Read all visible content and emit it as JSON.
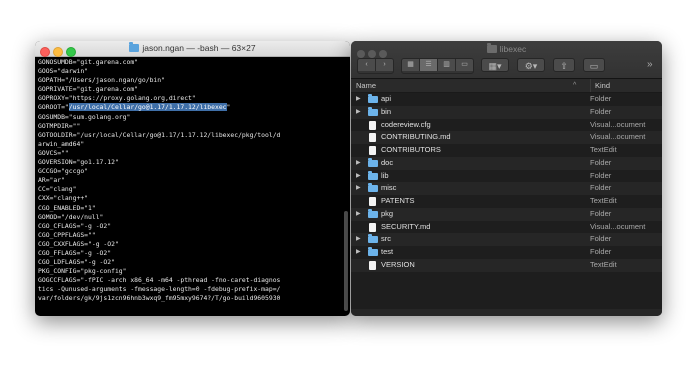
{
  "terminal": {
    "title": "jason.ngan — -bash — 63×27",
    "lines": [
      "GONOSUMDB=\"git.garena.com\"",
      "GOOS=\"darwin\"",
      "GOPATH=\"/Users/jason.ngan/go/bin\"",
      "GOPRIVATE=\"git.garena.com\"",
      "GOPROXY=\"https://proxy.golang.org,direct\"",
      "GOROOT=\"",
      "GOSUMDB=\"sum.golang.org\"",
      "GOTMPDIR=\"\"",
      "GOTOOLDIR=\"/usr/local/Cellar/go@1.17/1.17.12/libexec/pkg/tool/d",
      "arwin_amd64\"",
      "GOVCS=\"\"",
      "GOVERSION=\"go1.17.12\"",
      "GCCGO=\"gccgo\"",
      "AR=\"ar\"",
      "CC=\"clang\"",
      "CXX=\"clang++\"",
      "CGO_ENABLED=\"1\"",
      "GOMOD=\"/dev/null\"",
      "CGO_CFLAGS=\"-g -O2\"",
      "CGO_CPPFLAGS=\"\"",
      "CGO_CXXFLAGS=\"-g -O2\"",
      "CGO_FFLAGS=\"-g -O2\"",
      "CGO_LDFLAGS=\"-g -O2\"",
      "PKG_CONFIG=\"pkg-config\"",
      "GOGCCFLAGS=\"-fPIC -arch x86_64 -m64 -pthread -fno-caret-diagnos",
      "tics -Qunused-arguments -fmessage-length=0 -fdebug-prefix-map=/",
      "var/folders/gk/9js1zcn96hnb3wxq9_fm95mxy9674?/T/go-build9605930"
    ],
    "goroot_highlight": "/usr/local/Cellar/go@1.17/1.17.12/libexec",
    "goroot_suffix": "\""
  },
  "finder": {
    "title": "libexec",
    "col_name": "Name",
    "col_kind": "Kind",
    "toolbar": {
      "back": "‹",
      "forward": "›",
      "more": "»"
    },
    "rows": [
      {
        "name": "api",
        "kind": "Folder",
        "type": "folder"
      },
      {
        "name": "bin",
        "kind": "Folder",
        "type": "folder"
      },
      {
        "name": "codereview.cfg",
        "kind": "Visual...ocument",
        "type": "doc"
      },
      {
        "name": "CONTRIBUTING.md",
        "kind": "Visual...ocument",
        "type": "doc"
      },
      {
        "name": "CONTRIBUTORS",
        "kind": "TextEdit",
        "type": "doc"
      },
      {
        "name": "doc",
        "kind": "Folder",
        "type": "folder"
      },
      {
        "name": "lib",
        "kind": "Folder",
        "type": "folder"
      },
      {
        "name": "misc",
        "kind": "Folder",
        "type": "folder"
      },
      {
        "name": "PATENTS",
        "kind": "TextEdit",
        "type": "doc"
      },
      {
        "name": "pkg",
        "kind": "Folder",
        "type": "folder"
      },
      {
        "name": "SECURITY.md",
        "kind": "Visual...ocument",
        "type": "doc"
      },
      {
        "name": "src",
        "kind": "Folder",
        "type": "folder"
      },
      {
        "name": "test",
        "kind": "Folder",
        "type": "folder"
      },
      {
        "name": "VERSION",
        "kind": "TextEdit",
        "type": "doc"
      }
    ]
  }
}
